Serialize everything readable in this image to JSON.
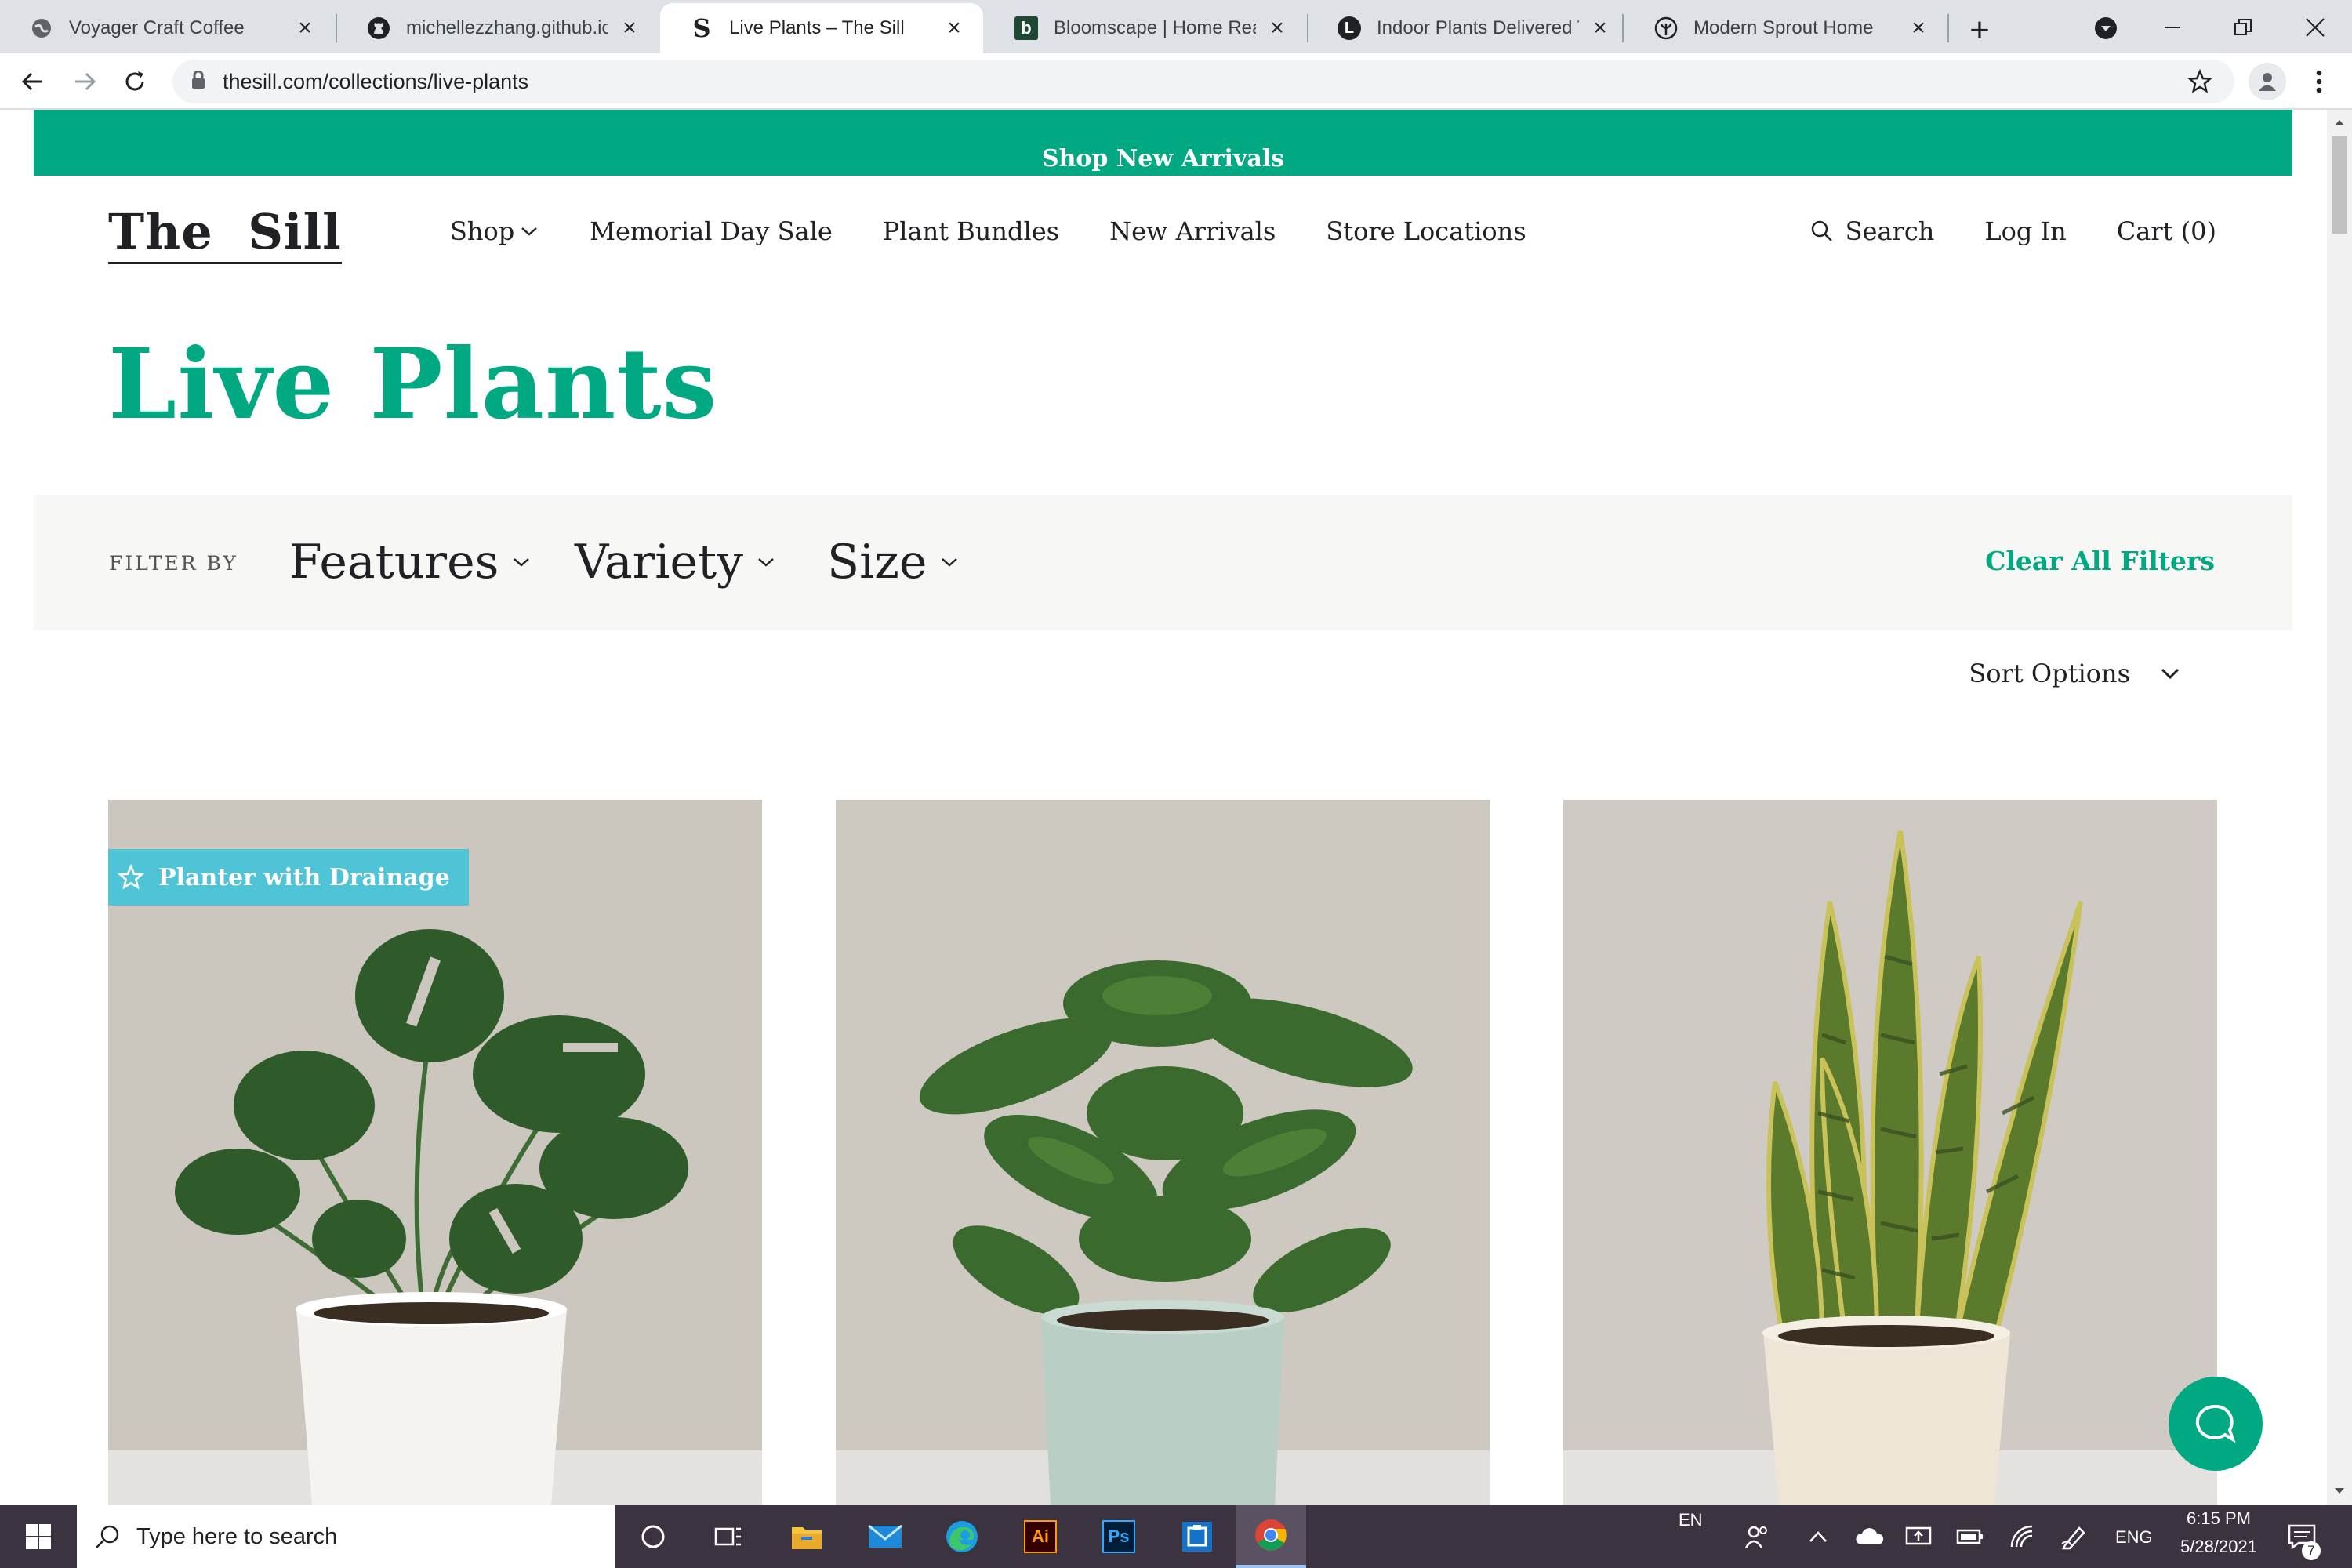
{
  "browser": {
    "tabs": [
      {
        "title": "Voyager Craft Coffee",
        "icon": "globe-icon",
        "active": false
      },
      {
        "title": "michellezzhang.github.io/g",
        "icon": "github-icon",
        "active": false
      },
      {
        "title": "Live Plants – The Sill",
        "icon": "sill-s-icon",
        "active": true
      },
      {
        "title": "Bloomscape | Home Ready",
        "icon": "bloomscape-b-icon",
        "active": false
      },
      {
        "title": "Indoor Plants Delivered To",
        "icon": "lively-l-icon",
        "active": false
      },
      {
        "title": "Modern Sprout Home",
        "icon": "modern-sprout-icon",
        "active": false
      }
    ],
    "new_tab": "+",
    "address": "thesill.com/collections/live-plants"
  },
  "site": {
    "promo": "Shop New Arrivals",
    "logo": "The Sill",
    "nav": [
      "Shop",
      "Memorial Day Sale",
      "Plant Bundles",
      "New Arrivals",
      "Store Locations"
    ],
    "search_label": "Search",
    "login_label": "Log In",
    "cart_label": "Cart (0)",
    "page_title": "Live Plants",
    "filter_by": "FILTER BY",
    "filters": [
      "Features",
      "Variety",
      "Size"
    ],
    "clear_filters": "Clear All Filters",
    "sort_options": "Sort Options",
    "products": [
      {
        "image": "monstera-plant-white-pot",
        "badge": "Planter with Drainage"
      },
      {
        "image": "coffee-plant-mint-pot",
        "badge": ""
      },
      {
        "image": "snake-plant-cream-pot",
        "badge": ""
      }
    ]
  },
  "taskbar": {
    "search_placeholder": "Type here to search",
    "lang_top": "EN",
    "lang": "ENG",
    "time": "6:15 PM",
    "date": "5/28/2021",
    "notification_count": "7"
  },
  "colors": {
    "brand_green": "#00a981",
    "badge_blue": "#4fc4d6",
    "tab_strip": "#dee1e6",
    "taskbar": "#3b3440"
  }
}
